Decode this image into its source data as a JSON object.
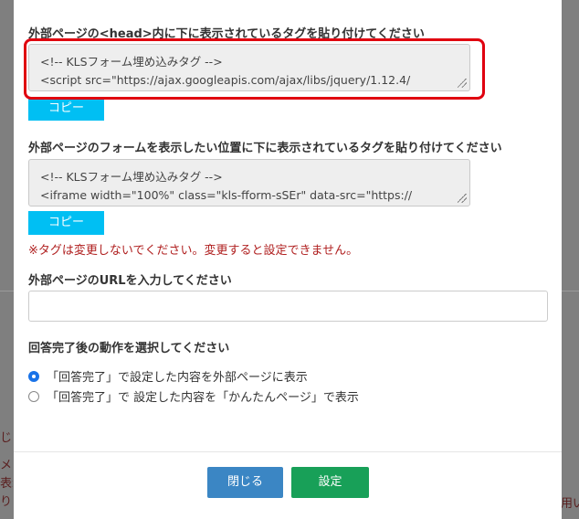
{
  "background": {
    "left_fragments": [
      "じ夕",
      "メ",
      "表示",
      "り "
    ],
    "right_fragment": "用い"
  },
  "modal": {
    "head_section": {
      "label": "外部ページの<head>内に下に表示されているタグを貼り付けてください",
      "code_line1": "<!-- KLSフォーム埋め込みタグ -->",
      "code_line2": "<script src=\"https://ajax.googleapis.com/ajax/libs/jquery/1.12.4/",
      "copy_label": "コピー"
    },
    "form_section": {
      "label": "外部ページのフォームを表示したい位置に下に表示されているタグを貼り付けてください",
      "code_line1": "<!-- KLSフォーム埋め込みタグ -->",
      "code_line2": "<iframe width=\"100%\" class=\"kls-fform-sSEr\" data-src=\"https://",
      "copy_label": "コピー",
      "warning": "※タグは変更しないでください。変更すると設定できません。"
    },
    "url_section": {
      "label": "外部ページのURLを入力してください",
      "value": ""
    },
    "action_section": {
      "label": "回答完了後の動作を選択してください",
      "options": [
        {
          "label": "「回答完了」で設定した内容を外部ページに表示",
          "checked": true
        },
        {
          "label": "「回答完了」で 設定した内容を「かんたんページ」で表示",
          "checked": false
        }
      ]
    },
    "footer": {
      "close_label": "閉じる",
      "set_label": "設定"
    },
    "colors": {
      "copy_button": "#00bff3",
      "close_button": "#3b86c4",
      "set_button": "#18a058",
      "highlight": "#e0000f",
      "warning": "#b02020"
    }
  }
}
